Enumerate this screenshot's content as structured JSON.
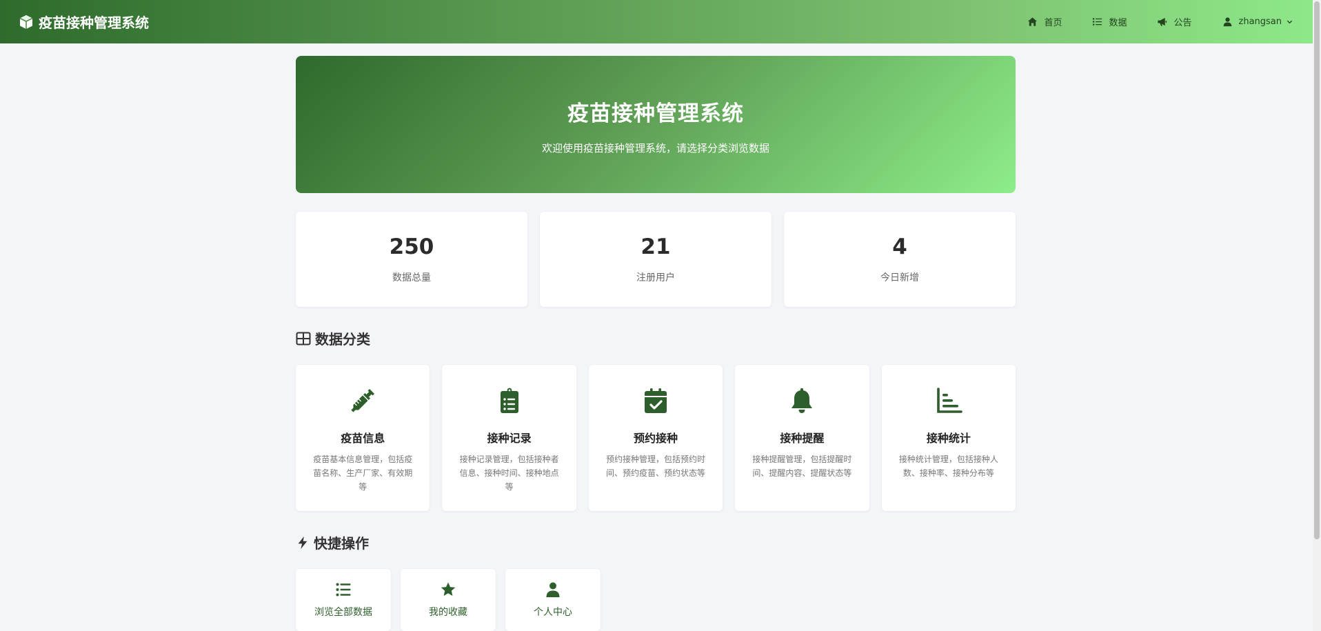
{
  "colors": {
    "accent": "#2e6b2c",
    "accent_light": "#8ee88a",
    "icon": "#2e5e2b"
  },
  "navbar": {
    "brand": "疫苗接种管理系统",
    "brand_icon": "cube-icon",
    "items": [
      {
        "label": "首页",
        "icon": "home-icon"
      },
      {
        "label": "数据",
        "icon": "list-icon"
      },
      {
        "label": "公告",
        "icon": "megaphone-icon"
      }
    ],
    "user": {
      "name": "zhangsan",
      "icon": "user-icon"
    }
  },
  "hero": {
    "title": "疫苗接种管理系统",
    "subtitle": "欢迎使用疫苗接种管理系统，请选择分类浏览数据"
  },
  "stats": [
    {
      "value": "250",
      "label": "数据总量"
    },
    {
      "value": "21",
      "label": "注册用户"
    },
    {
      "value": "4",
      "label": "今日新增"
    }
  ],
  "categories_section": {
    "title": "数据分类",
    "icon": "grid-icon"
  },
  "categories": [
    {
      "name": "疫苗信息",
      "icon": "syringe-icon",
      "desc": "疫苗基本信息管理，包括疫苗名称、生产厂家、有效期等"
    },
    {
      "name": "接种记录",
      "icon": "clipboard-list-icon",
      "desc": "接种记录管理，包括接种者信息、接种时间、接种地点等"
    },
    {
      "name": "预约接种",
      "icon": "calendar-check-icon",
      "desc": "预约接种管理，包括预约时间、预约疫苗、预约状态等"
    },
    {
      "name": "接种提醒",
      "icon": "bell-icon",
      "desc": "接种提醒管理，包括提醒时间、提醒内容、提醒状态等"
    },
    {
      "name": "接种统计",
      "icon": "chart-icon",
      "desc": "接种统计管理，包括接种人数、接种率、接种分布等"
    }
  ],
  "quick_section": {
    "title": "快捷操作",
    "icon": "bolt-icon"
  },
  "quick_actions": [
    {
      "label": "浏览全部数据",
      "icon": "list-icon"
    },
    {
      "label": "我的收藏",
      "icon": "star-icon"
    },
    {
      "label": "个人中心",
      "icon": "user-icon"
    }
  ]
}
